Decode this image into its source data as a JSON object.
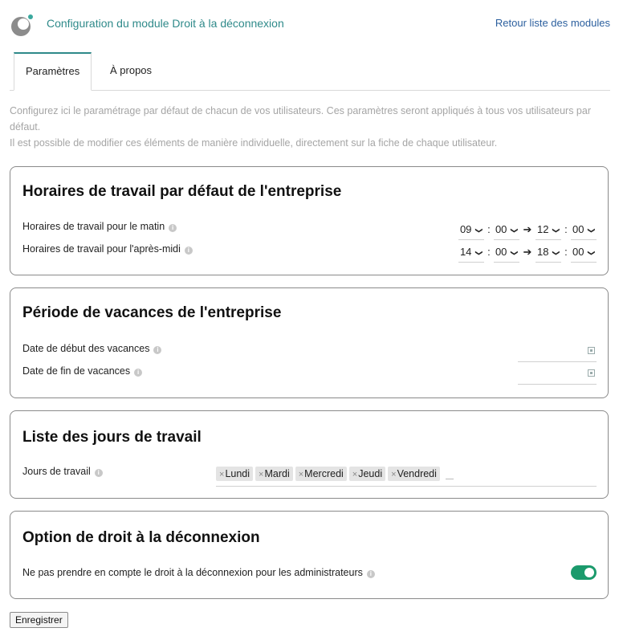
{
  "header": {
    "module_title": "Configuration du module Droit à la déconnexion",
    "back_link": "Retour liste des modules"
  },
  "tabs": [
    {
      "label": "Paramètres",
      "active": true
    },
    {
      "label": "À propos",
      "active": false
    }
  ],
  "intro": {
    "line1": "Configurez ici le paramétrage par défaut de chacun de vos utilisateurs. Ces paramètres seront appliqués à tous vos utilisateurs par défaut.",
    "line2": "Il est possible de modifier ces éléments de manière individuelle, directement sur la fiche de chaque utilisateur."
  },
  "working_hours": {
    "title": "Horaires de travail par défaut de l'entreprise",
    "morning": {
      "label": "Horaires de travail pour le matin",
      "start_hour": "09",
      "start_min": "00",
      "end_hour": "12",
      "end_min": "00"
    },
    "afternoon": {
      "label": "Horaires de travail pour l'après-midi",
      "start_hour": "14",
      "start_min": "00",
      "end_hour": "18",
      "end_min": "00"
    }
  },
  "vacation": {
    "title": "Période de vacances de l'entreprise",
    "start_label": "Date de début des vacances",
    "start_value": "",
    "end_label": "Date de fin de vacances",
    "end_value": ""
  },
  "work_days": {
    "title": "Liste des jours de travail",
    "label": "Jours de travail",
    "remove_glyph": "×",
    "days": [
      "Lundi",
      "Mardi",
      "Mercredi",
      "Jeudi",
      "Vendredi"
    ]
  },
  "disconnect_option": {
    "title": "Option de droit à la déconnexion",
    "label": "Ne pas prendre en compte le droit à la déconnexion pour les administrateurs",
    "toggle_on": true
  },
  "info_glyph": "i",
  "arrow_glyph": "➔",
  "colon_glyph": ":",
  "chevron_glyph": "❯",
  "save_label": "Enregistrer",
  "colors": {
    "accent": "#2f8a8a",
    "link": "#2b5f9e",
    "toggle": "#1b9a6c"
  }
}
